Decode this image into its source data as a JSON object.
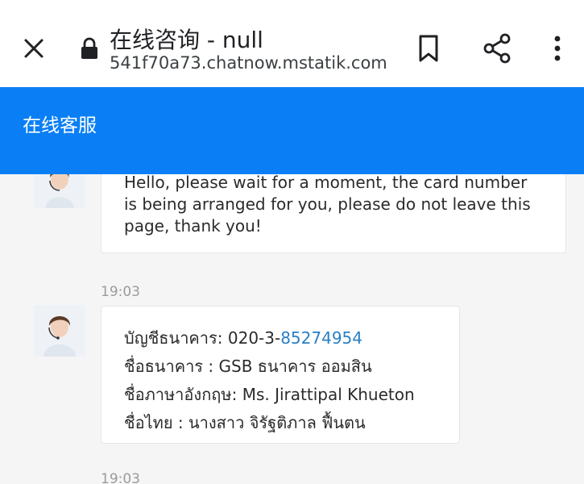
{
  "browser": {
    "title": "在线咨询 - null",
    "url": "541f70a73.chatnow.mstatik.com"
  },
  "chat_header": {
    "title": "在线客服"
  },
  "messages": [
    {
      "lines": [
        "Hello, please wait for a moment, the card number",
        "is being arranged for you, please do not leave this",
        "page, thank you!"
      ]
    },
    {
      "time": "19:03",
      "account_prefix": "บัญชีธนาคาร: 020-3-",
      "account_link": "85274954",
      "lines": [
        "ชื่อธนาคาร :  GSB ธนาคาร ออมสิน",
        "ชื่อภาษาอังกฤษ: Ms. Jirattipal Khueton",
        "ชื่อไทย  : นางสาว จิรัฐติภาล ฟื้นตน"
      ]
    },
    {
      "time": "19:03"
    }
  ],
  "icons": {
    "close": "close-icon",
    "lock": "lock-icon",
    "bookmark": "bookmark-icon",
    "share": "share-icon",
    "more": "more-vertical-icon",
    "avatar": "agent-avatar"
  },
  "colors": {
    "header_blue": "#0a7ff5",
    "link_blue": "#2a7fc4"
  }
}
